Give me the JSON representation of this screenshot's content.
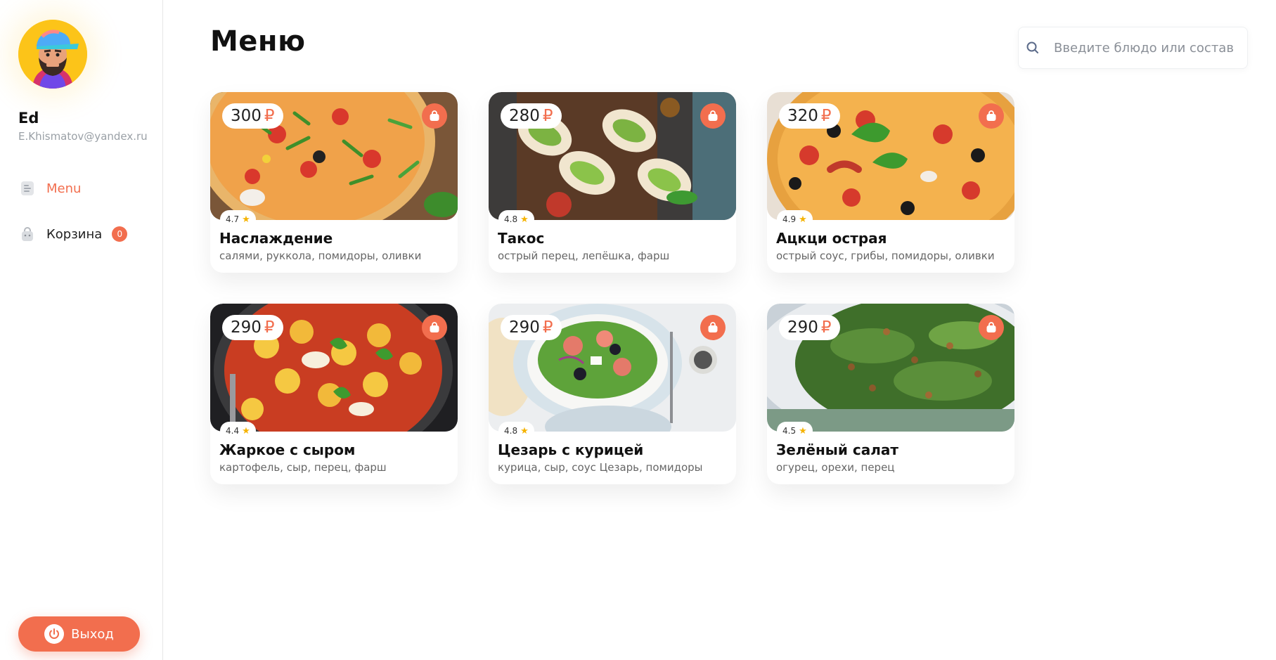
{
  "sidebar": {
    "profile": {
      "name": "Ed",
      "email": "E.Khismatov@yandex.ru"
    },
    "nav": [
      {
        "label": "Menu",
        "icon": "menu-icon",
        "active": true
      },
      {
        "label": "Корзина",
        "icon": "cart-icon",
        "badge": "0"
      }
    ],
    "logout_label": "Выход"
  },
  "header": {
    "title": "Меню",
    "search": {
      "placeholder": "Введите блюдо или состав",
      "value": ""
    }
  },
  "accent_color": "#f26e4e",
  "dishes": [
    {
      "price": "300",
      "currency": "₽",
      "rating": "4.7",
      "name": "Наслаждение",
      "ingredients": "салями, руккола, помидоры, оливки",
      "image": "pizza-arugula"
    },
    {
      "price": "280",
      "currency": "₽",
      "rating": "4.8",
      "name": "Такос",
      "ingredients": "острый перец, лепёшка, фарш",
      "image": "tacos"
    },
    {
      "price": "320",
      "currency": "₽",
      "rating": "4.9",
      "name": "Ацкци острая",
      "ingredients": "острый соус, грибы, помидоры, оливки",
      "image": "pizza-spicy"
    },
    {
      "price": "290",
      "currency": "₽",
      "rating": "4.4",
      "name": "Жаркое с сыром",
      "ingredients": "картофель, сыр, перец, фарш",
      "image": "gnocchi-pan"
    },
    {
      "price": "290",
      "currency": "₽",
      "rating": "4.8",
      "name": "Цезарь с курицей",
      "ingredients": "курица, сыр, соус Цезарь, помидоры",
      "image": "caesar-salad"
    },
    {
      "price": "290",
      "currency": "₽",
      "rating": "4.5",
      "name": "Зелёный салат",
      "ingredients": "огурец, орехи, перец",
      "image": "green-salad"
    }
  ]
}
